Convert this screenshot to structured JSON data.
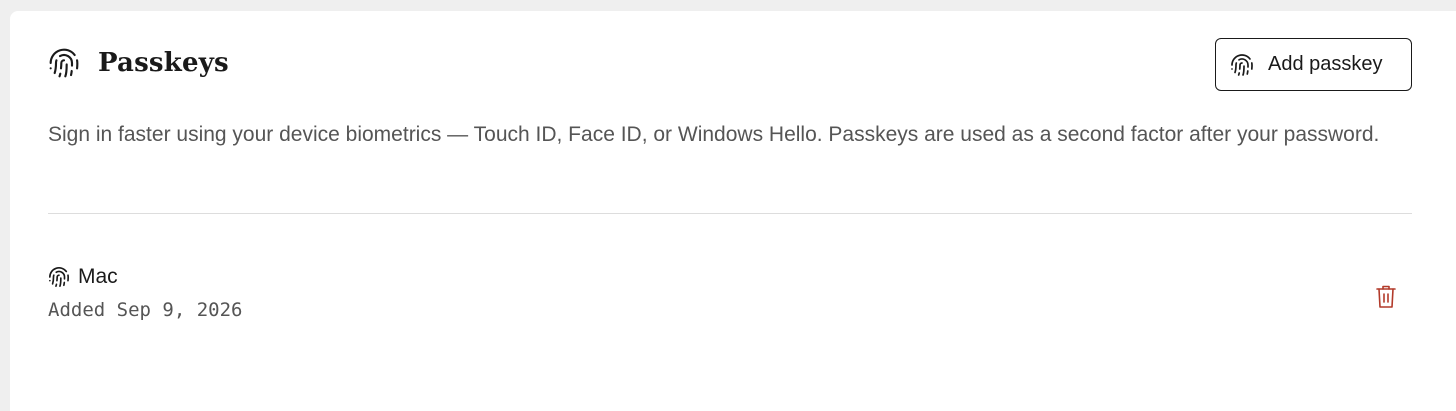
{
  "section": {
    "title": "Passkeys",
    "icon": "fingerprint-icon",
    "description": "Sign in faster using your device biometrics — Touch ID, Face ID, or Windows Hello. Passkeys are used as a second factor after your password."
  },
  "add_button": {
    "label": "Add passkey",
    "icon": "fingerprint-icon"
  },
  "passkeys": [
    {
      "name": "Mac",
      "added": "Added Sep 9, 2026",
      "icon": "fingerprint-icon",
      "delete_icon": "trash-icon"
    }
  ],
  "colors": {
    "text": "#1a1a1a",
    "muted": "#555555",
    "delete": "#b23a2a",
    "divider": "#dddddd"
  }
}
